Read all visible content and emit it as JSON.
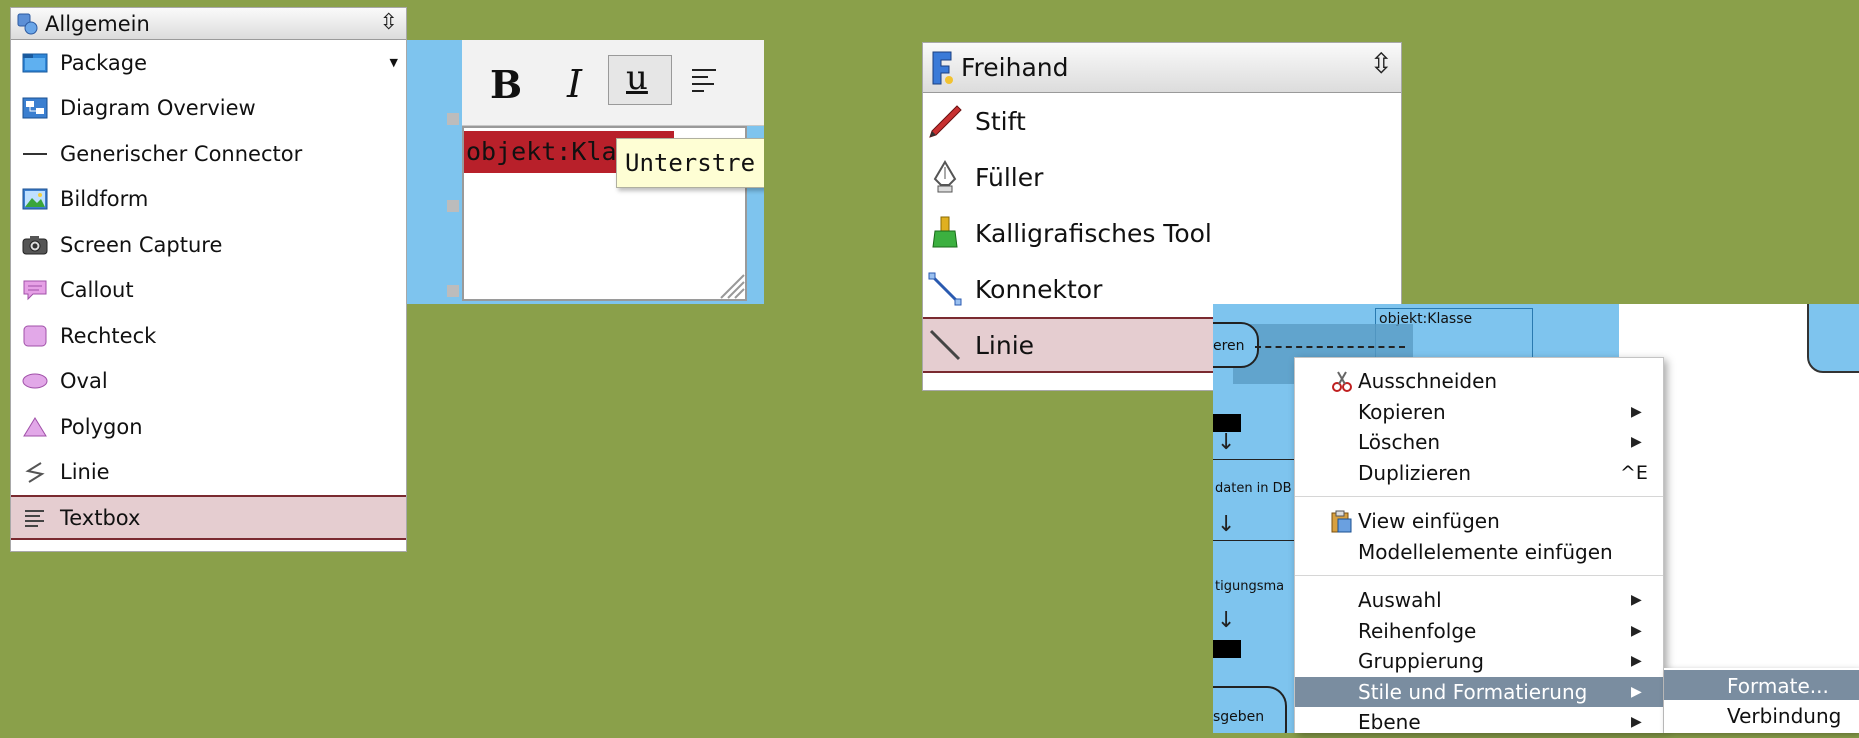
{
  "palette_general": {
    "title": "Allgemein",
    "move_icon": "move-vertical-icon",
    "items": [
      {
        "label": "Package",
        "icon": "package-icon"
      },
      {
        "label": "Diagram Overview",
        "icon": "diagram-overview-icon"
      },
      {
        "label": "Generischer Connector",
        "icon": "connector-line-icon"
      },
      {
        "label": "Bildform",
        "icon": "image-icon"
      },
      {
        "label": "Screen Capture",
        "icon": "camera-icon"
      },
      {
        "label": "Callout",
        "icon": "callout-icon"
      },
      {
        "label": "Rechteck",
        "icon": "rectangle-icon"
      },
      {
        "label": "Oval",
        "icon": "oval-icon"
      },
      {
        "label": "Polygon",
        "icon": "polygon-icon"
      },
      {
        "label": "Linie",
        "icon": "line-icon"
      },
      {
        "label": "Textbox",
        "icon": "textbox-icon",
        "selected": true
      }
    ]
  },
  "text_editor": {
    "toolbar": {
      "bold": "B",
      "italic": "I",
      "underline": "u"
    },
    "text_value": "objekt:Kla",
    "tooltip": "Unterstre"
  },
  "palette_freehand": {
    "title": "Freihand",
    "items": [
      {
        "label": "Stift",
        "icon": "pencil-icon"
      },
      {
        "label": "Füller",
        "icon": "fountain-pen-icon"
      },
      {
        "label": "Kalligrafisches Tool",
        "icon": "calligraphy-icon"
      },
      {
        "label": "Konnektor",
        "icon": "connector-icon"
      },
      {
        "label": "Linie",
        "icon": "line-icon",
        "selected": true
      }
    ]
  },
  "diagram": {
    "object_label": "objekt:Klasse",
    "labels": {
      "eren": "eren",
      "daten": "daten in DB",
      "tigungs": "tigungsma",
      "geben": "sgeben"
    }
  },
  "context_menu": {
    "items": [
      {
        "label": "Ausschneiden",
        "icon": "scissors-icon"
      },
      {
        "label": "Kopieren",
        "submenu": true
      },
      {
        "label": "Löschen",
        "submenu": true
      },
      {
        "label": "Duplizieren",
        "shortcut": "^E"
      },
      {
        "label": "View einfügen",
        "icon": "clipboard-icon"
      },
      {
        "label": "Modellelemente einfügen"
      },
      {
        "label": "Auswahl",
        "submenu": true
      },
      {
        "label": "Reihenfolge",
        "submenu": true
      },
      {
        "label": "Gruppierung",
        "submenu": true
      },
      {
        "label": "Stile und Formatierung",
        "submenu": true,
        "highlighted": true
      },
      {
        "label": "Ebene",
        "submenu": true
      }
    ],
    "submenu": [
      {
        "label": "Formate...",
        "highlighted": true
      },
      {
        "label": "Verbindung"
      }
    ],
    "arrow": "▶"
  }
}
